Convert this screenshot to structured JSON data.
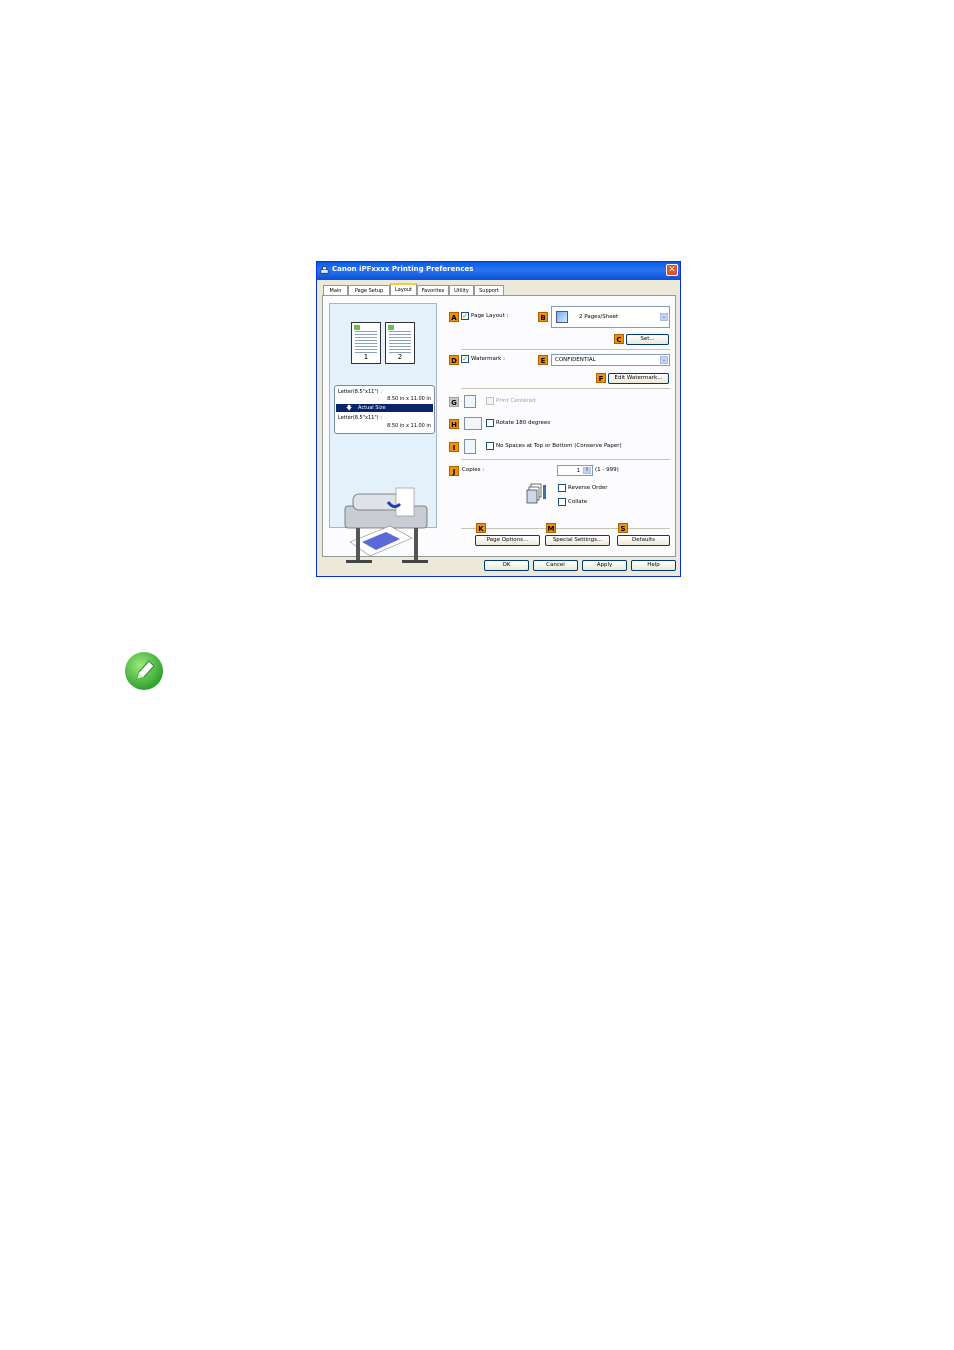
{
  "window": {
    "title": "Canon iPFxxxx Printing Preferences"
  },
  "tabs": [
    {
      "label": "Main",
      "active": false
    },
    {
      "label": "Page Setup",
      "active": false
    },
    {
      "label": "Layout",
      "active": true
    },
    {
      "label": "Favorites",
      "active": false
    },
    {
      "label": "Utility",
      "active": false
    },
    {
      "label": "Support",
      "active": false
    }
  ],
  "preview": {
    "page_numbers": [
      "1",
      "2"
    ],
    "size_box": {
      "original_label": "Letter(8.5\"x11\") :",
      "original_dims": "8.50 in x 11.00 in",
      "scaling": "Actual Size",
      "output_label": "Letter(8.5\"x11\") :",
      "output_dims": "8.50 in x 11.00 in"
    }
  },
  "labels": {
    "A": "A",
    "B": "B",
    "C": "C",
    "D": "D",
    "E": "E",
    "F": "F",
    "G": "G",
    "H": "H",
    "I": "I",
    "J": "J",
    "K": "K",
    "M": "M",
    "S": "S"
  },
  "page_layout": {
    "label": "Page Layout :",
    "checked": true,
    "selected": "2 Pages/Sheet",
    "set_button": "Set..."
  },
  "watermark": {
    "label": "Watermark :",
    "checked": true,
    "selected": "CONFIDENTIAL",
    "edit_button": "Edit Watermark..."
  },
  "print_centered": {
    "label": "Print Centered",
    "checked": false,
    "enabled": false
  },
  "rotate": {
    "label": "Rotate 180 degrees",
    "checked": false
  },
  "no_spaces": {
    "label": "No Spaces at Top or Bottom (Conserve Paper)",
    "checked": false
  },
  "copies": {
    "label": "Copies :",
    "value": "1",
    "range": "(1 - 999)",
    "reverse_order": "Reverse Order",
    "collate": "Collate"
  },
  "bottom_buttons": {
    "page_options": "Page Options...",
    "special_settings": "Special Settings...",
    "defaults": "Defaults"
  },
  "dialog_buttons": {
    "ok": "OK",
    "cancel": "Cancel",
    "apply": "Apply",
    "help": "Help"
  },
  "colors": {
    "title_bar": "#0a5ae6",
    "label_badge": "#f0910e",
    "selection": "#0a246a",
    "note_icon": "#3fbf3f"
  }
}
